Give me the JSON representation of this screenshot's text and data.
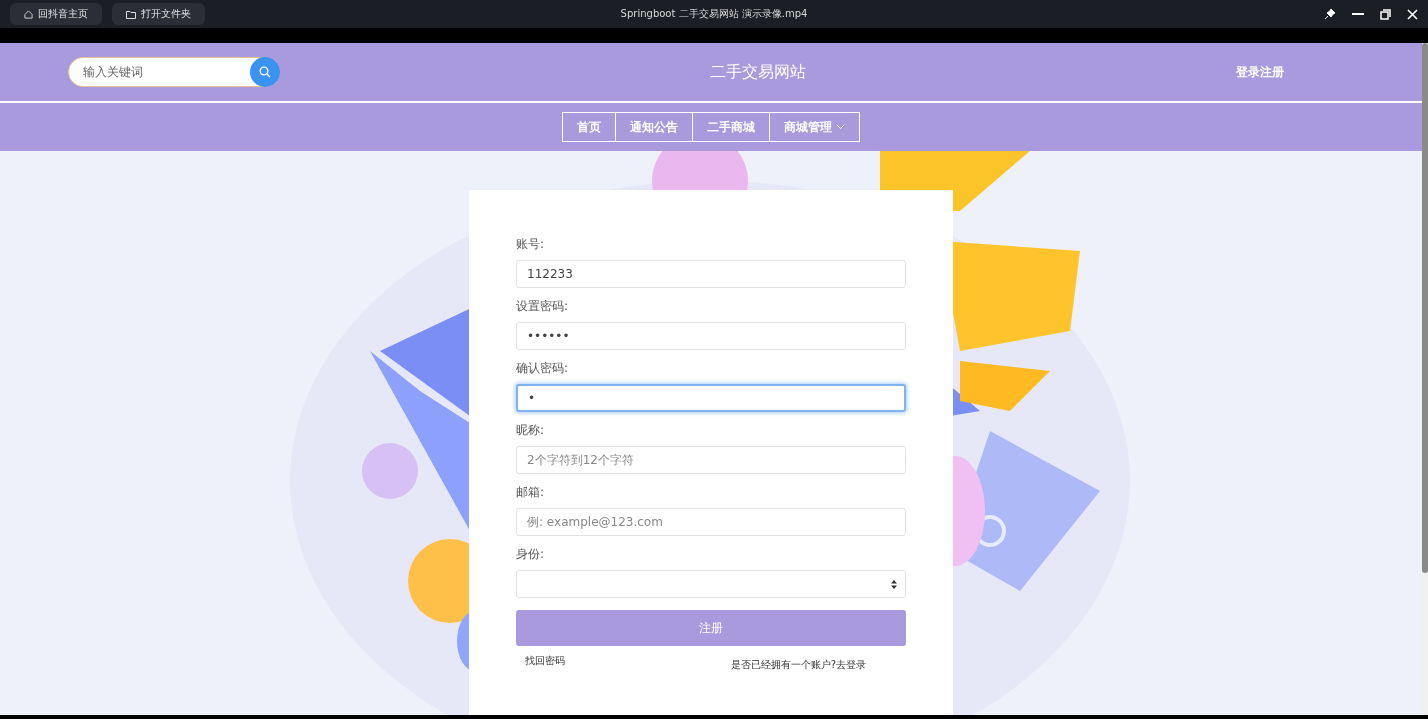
{
  "player_bar": {
    "buttons": [
      {
        "label": "回抖音主页",
        "kind": "home"
      },
      {
        "label": "打开文件夹",
        "kind": "folder"
      }
    ],
    "title": "Springboot 二手交易网站 演示录像.mp4"
  },
  "header": {
    "search": {
      "placeholder": "输入关键词"
    },
    "site_title": "二手交易网站",
    "auth_link": "登录注册"
  },
  "nav": [
    {
      "label": "首页",
      "dropdown": false
    },
    {
      "label": "通知公告",
      "dropdown": false
    },
    {
      "label": "二手商城",
      "dropdown": false
    },
    {
      "label": "商城管理",
      "dropdown": true
    }
  ],
  "form": {
    "fields": [
      {
        "label": "账号:",
        "kind": "input",
        "value": "112233",
        "focused": false
      },
      {
        "label": "设置密码:",
        "kind": "input",
        "value": "••••••",
        "focused": false
      },
      {
        "label": "确认密码:",
        "kind": "input",
        "value": "•",
        "focused": true
      },
      {
        "label": "昵称:",
        "kind": "input",
        "placeholder": "2个字符到12个字符",
        "focused": false
      },
      {
        "label": "邮箱:",
        "kind": "input",
        "placeholder": "例: example@123.com",
        "focused": false
      },
      {
        "label": "身份:",
        "kind": "select"
      }
    ],
    "submit": "注册",
    "forgot_link": "找回密码",
    "login_link": "是否已经拥有一个账户?去登录"
  }
}
